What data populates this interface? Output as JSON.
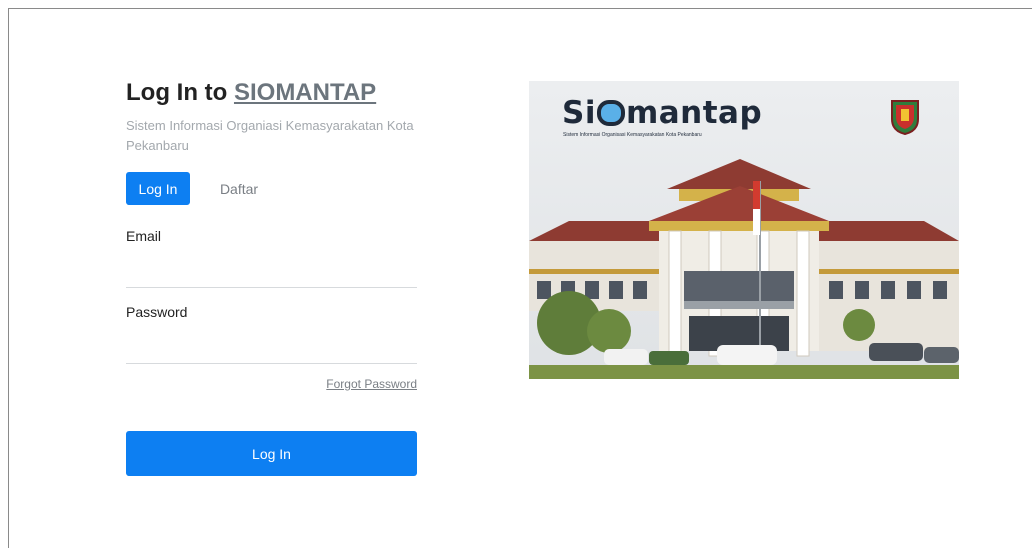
{
  "header": {
    "title_prefix": "Log In to ",
    "title_brand": "SIOMANTAP",
    "subtitle": "Sistem Informasi Organiasi Kemasyarakatan Kota Pekanbaru"
  },
  "tabs": [
    {
      "label": "Log In",
      "active": true
    },
    {
      "label": "Daftar",
      "active": false
    }
  ],
  "form": {
    "email_label": "Email",
    "email_value": "",
    "password_label": "Password",
    "password_value": "",
    "forgot_label": "Forgot Password",
    "submit_label": "Log In"
  },
  "banner": {
    "logo_text_pre": "Si",
    "logo_text_post": "mantap",
    "logo_subtext": "Sistem Informasi Organisasi Kemasyarakatan Kota Pekanbaru"
  },
  "colors": {
    "primary": "#0d7ff2",
    "brand_link": "#6c757d",
    "muted": "#a3a8ad"
  }
}
